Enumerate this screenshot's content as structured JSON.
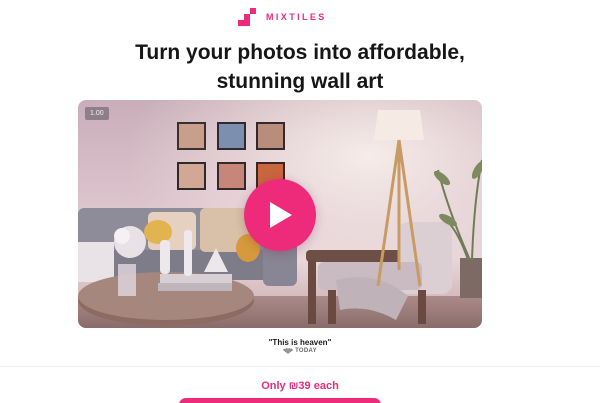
{
  "brand": {
    "name": "MIXTILES",
    "color": "#ee2a7b"
  },
  "hero": {
    "headline_line1": "Turn your photos into affordable,",
    "headline_line2": "stunning wall art"
  },
  "video": {
    "speed_badge": "1.00",
    "play_icon": "play-icon"
  },
  "testimonial": {
    "quote": "\"This is heaven\"",
    "source": "TODAY"
  },
  "pricing": {
    "price_text": "Only ₪39 each"
  }
}
